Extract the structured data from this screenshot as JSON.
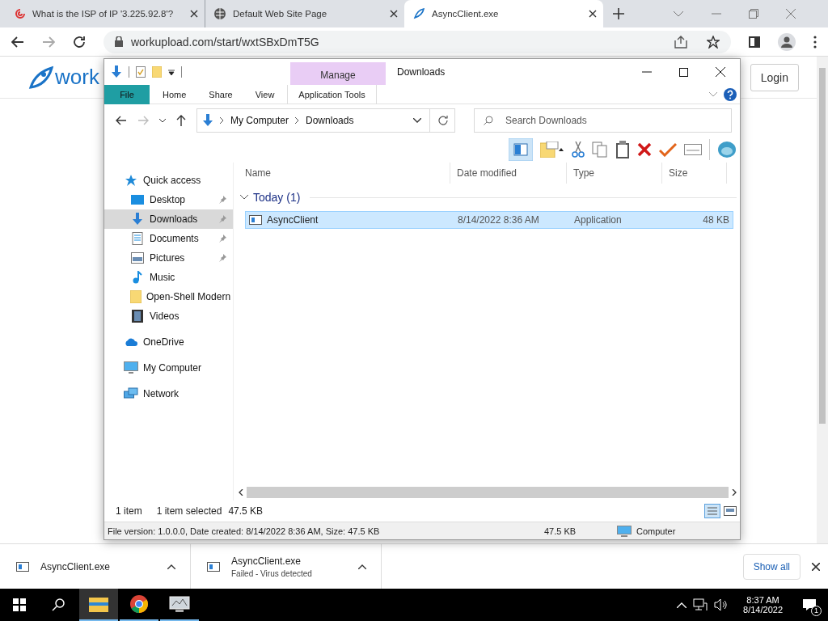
{
  "browser": {
    "tabs": [
      {
        "title": "What is the ISP of IP '3.225.92.8'?",
        "selected": false
      },
      {
        "title": "Default Web Site Page",
        "selected": false
      },
      {
        "title": "AsyncClient.exe",
        "selected": true
      }
    ],
    "address": "workupload.com/start/wxtSBxDmT5G"
  },
  "page": {
    "logo_text": "work",
    "login": "Login"
  },
  "explorer": {
    "title": "Downloads",
    "context_group": "Manage",
    "ribbon_tabs": [
      {
        "label": "File",
        "kind": "file"
      },
      {
        "label": "Home",
        "kind": "plain"
      },
      {
        "label": "Share",
        "kind": "plain"
      },
      {
        "label": "View",
        "kind": "plain"
      },
      {
        "label": "Application Tools",
        "kind": "contextual"
      }
    ],
    "breadcrumb": [
      "My Computer",
      "Downloads"
    ],
    "search": {
      "placeholder": "Search Downloads"
    },
    "sidebar": [
      {
        "label": "Quick access",
        "pinned": false,
        "selected": false,
        "children": [
          {
            "label": "Desktop",
            "pinned": true,
            "selected": false
          },
          {
            "label": "Downloads",
            "pinned": true,
            "selected": true
          },
          {
            "label": "Documents",
            "pinned": true,
            "selected": false
          },
          {
            "label": "Pictures",
            "pinned": true,
            "selected": false
          },
          {
            "label": "Music",
            "pinned": false,
            "selected": false
          },
          {
            "label": "Open-Shell Modern",
            "pinned": false,
            "selected": false
          },
          {
            "label": "Videos",
            "pinned": false,
            "selected": false
          }
        ]
      },
      {
        "label": "OneDrive",
        "pinned": false,
        "selected": false
      },
      {
        "label": "My Computer",
        "pinned": false,
        "selected": false
      },
      {
        "label": "Network",
        "pinned": false,
        "selected": false
      }
    ],
    "columns": [
      "Name",
      "Date modified",
      "Type",
      "Size"
    ],
    "group": "Today (1)",
    "files": [
      {
        "name": "AsyncClient",
        "date": "8/14/2022 8:36 AM",
        "type": "Application",
        "size": "48 KB",
        "selected": true
      }
    ],
    "status": {
      "count": "1 item",
      "selected": "1 item selected",
      "size": "47.5 KB"
    },
    "details": {
      "info": "File version: 1.0.0.0, Date created: 8/14/2022 8:36 AM, Size: 47.5 KB",
      "size": "47.5 KB",
      "location": "Computer"
    }
  },
  "downloads": {
    "items": [
      {
        "name": "AsyncClient.exe"
      },
      {
        "name": "AsyncClient.exe",
        "status": "Failed - Virus detected"
      }
    ],
    "show_all": "Show all"
  },
  "taskbar": {
    "apps": [
      {
        "selected": true
      },
      {
        "selected": false
      },
      {
        "selected": false
      }
    ],
    "time": "8:37 AM",
    "date": "8/14/2022",
    "notifications": "1"
  }
}
